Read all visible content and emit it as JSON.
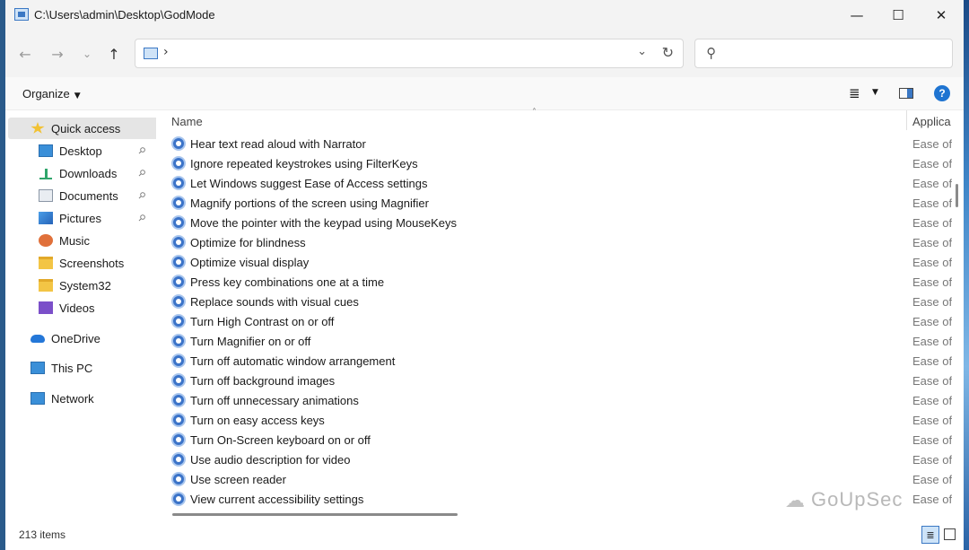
{
  "window": {
    "title": "C:\\Users\\admin\\Desktop\\GodMode",
    "minimize_glyph": "—",
    "maximize_glyph": "☐",
    "close_glyph": "✕"
  },
  "navigation": {
    "back_glyph": "←",
    "forward_glyph": "→",
    "recent_glyph": "⌄",
    "up_glyph": "↑",
    "address_chevron": "›",
    "address_dropdown_glyph": "⌄",
    "refresh_glyph": "↻",
    "search_glyph": "⚲",
    "search_placeholder": ""
  },
  "toolbar": {
    "organize_label": "Organize",
    "view_glyph": "≣",
    "help_glyph": "?"
  },
  "sidebar": {
    "items": [
      {
        "label": "Quick access",
        "icon": "star-icon",
        "pinned": false,
        "selected": true
      },
      {
        "label": "Desktop",
        "icon": "desktop-icon",
        "pinned": true
      },
      {
        "label": "Downloads",
        "icon": "download-icon",
        "pinned": true
      },
      {
        "label": "Documents",
        "icon": "document-icon",
        "pinned": true
      },
      {
        "label": "Pictures",
        "icon": "pictures-icon",
        "pinned": true
      },
      {
        "label": "Music",
        "icon": "music-icon",
        "pinned": false
      },
      {
        "label": "Screenshots",
        "icon": "folder-icon",
        "pinned": false
      },
      {
        "label": "System32",
        "icon": "folder-icon",
        "pinned": false
      },
      {
        "label": "Videos",
        "icon": "videos-icon",
        "pinned": false
      },
      {
        "label": "OneDrive",
        "icon": "onedrive-icon",
        "pinned": false
      },
      {
        "label": "This PC",
        "icon": "computer-icon",
        "pinned": false
      },
      {
        "label": "Network",
        "icon": "network-icon",
        "pinned": false
      }
    ],
    "pin_glyph": "📌"
  },
  "list": {
    "columns": {
      "name": "Name",
      "application": "Applica"
    },
    "sort_glyph": "˄",
    "rows": [
      {
        "name": "Hear text read aloud with Narrator",
        "application": "Ease of"
      },
      {
        "name": "Ignore repeated keystrokes using FilterKeys",
        "application": "Ease of"
      },
      {
        "name": "Let Windows suggest Ease of Access settings",
        "application": "Ease of"
      },
      {
        "name": "Magnify portions of the screen using Magnifier",
        "application": "Ease of"
      },
      {
        "name": "Move the pointer with the keypad using MouseKeys",
        "application": "Ease of"
      },
      {
        "name": "Optimize for blindness",
        "application": "Ease of"
      },
      {
        "name": "Optimize visual display",
        "application": "Ease of"
      },
      {
        "name": "Press key combinations one at a time",
        "application": "Ease of"
      },
      {
        "name": "Replace sounds with visual cues",
        "application": "Ease of"
      },
      {
        "name": "Turn High Contrast on or off",
        "application": "Ease of"
      },
      {
        "name": "Turn Magnifier on or off",
        "application": "Ease of"
      },
      {
        "name": "Turn off automatic window arrangement",
        "application": "Ease of"
      },
      {
        "name": "Turn off background images",
        "application": "Ease of"
      },
      {
        "name": "Turn off unnecessary animations",
        "application": "Ease of"
      },
      {
        "name": "Turn on easy access keys",
        "application": "Ease of"
      },
      {
        "name": "Turn On-Screen keyboard on or off",
        "application": "Ease of"
      },
      {
        "name": "Use audio description for video",
        "application": "Ease of"
      },
      {
        "name": "Use screen reader",
        "application": "Ease of"
      },
      {
        "name": "View current accessibility settings",
        "application": "Ease of"
      }
    ]
  },
  "status": {
    "item_count": "213 items",
    "details_glyph": "≣"
  },
  "watermark": {
    "text": "GoUpSec",
    "icon_glyph": "☁"
  },
  "colors": {
    "accent": "#1f74d1",
    "row_icon": "#3b73c8",
    "selected_bg": "#e5e5e5"
  }
}
